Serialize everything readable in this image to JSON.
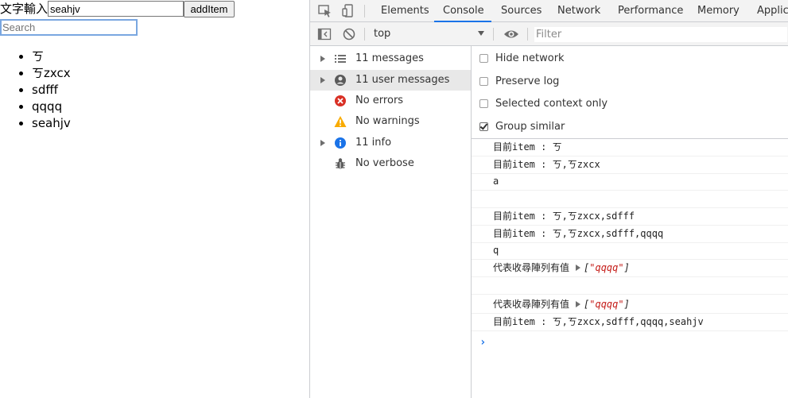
{
  "page": {
    "text_label": "文字輸入",
    "text_value": "seahjv",
    "add_button": "addItem",
    "search_placeholder": "Search",
    "items": [
      "ㄎ",
      "ㄎzxcx",
      "sdfff",
      "qqqq",
      "seahjv"
    ]
  },
  "devtools": {
    "tabs": [
      "Elements",
      "Console",
      "Sources",
      "Network",
      "Performance",
      "Memory",
      "Applica"
    ],
    "active_tab": "Console",
    "context": "top",
    "filter_placeholder": "Filter",
    "sidebar": [
      {
        "label": "11 messages",
        "icon": "list-icon",
        "expandable": true,
        "selected": false
      },
      {
        "label": "11 user messages",
        "icon": "user-icon",
        "expandable": true,
        "selected": true
      },
      {
        "label": "No errors",
        "icon": "error-icon",
        "expandable": false,
        "selected": false
      },
      {
        "label": "No warnings",
        "icon": "warning-icon",
        "expandable": false,
        "selected": false
      },
      {
        "label": "11 info",
        "icon": "info-icon",
        "expandable": true,
        "selected": false
      },
      {
        "label": "No verbose",
        "icon": "bug-icon",
        "expandable": false,
        "selected": false
      }
    ],
    "settings": [
      {
        "label": "Hide network",
        "checked": false
      },
      {
        "label": "Preserve log",
        "checked": false
      },
      {
        "label": "Selected context only",
        "checked": false
      },
      {
        "label": "Group similar",
        "checked": true
      }
    ],
    "messages": [
      {
        "text": "目前item : ㄎ"
      },
      {
        "text": "目前item : ㄎ,ㄎzxcx"
      },
      {
        "text": "a"
      },
      {
        "text": ""
      },
      {
        "text": "目前item : ㄎ,ㄎzxcx,sdfff"
      },
      {
        "text": "目前item : ㄎ,ㄎzxcx,sdfff,qqqq"
      },
      {
        "text": "q"
      },
      {
        "text": "代表收尋陣列有值",
        "array": "qqqq"
      },
      {
        "text": ""
      },
      {
        "text": "代表收尋陣列有值",
        "array": "qqqq"
      },
      {
        "text": "目前item : ㄎ,ㄎzxcx,sdfff,qqqq,seahjv"
      }
    ],
    "prompt_symbol": "›",
    "colors": {
      "accent": "#1a73e8",
      "error": "#d93025",
      "warning": "#f9ab00",
      "info": "#1a73e8",
      "string": "#c41a16"
    }
  }
}
